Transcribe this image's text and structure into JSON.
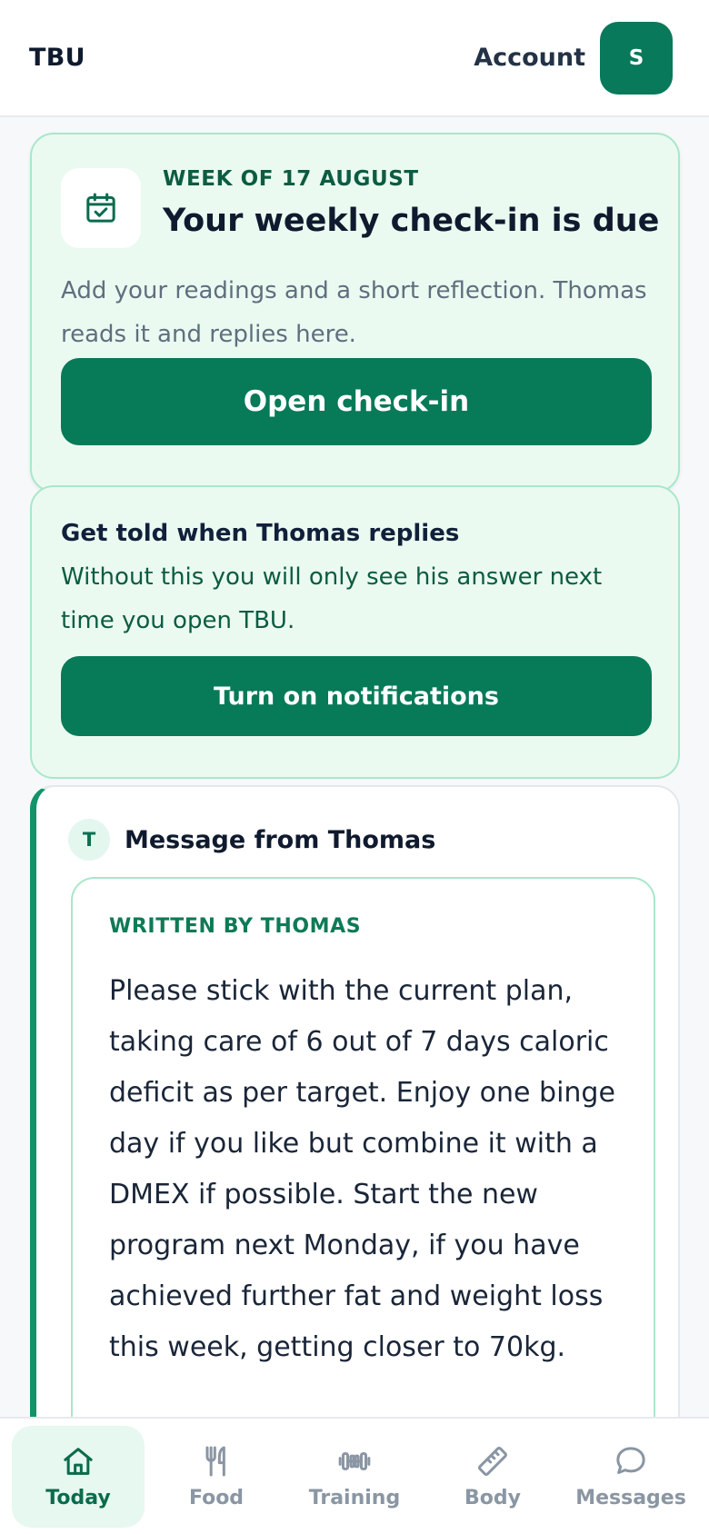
{
  "header": {
    "brand": "TBU",
    "account_label": "Account",
    "avatar_initial": "S"
  },
  "checkin_card": {
    "week_label": "WEEK OF 17 AUGUST",
    "title": "Your weekly check-in is due",
    "description": "Add your readings and a short reflection. Thomas reads it and replies here.",
    "button_label": "Open check-in",
    "icon": "calendar-check-icon"
  },
  "notify_card": {
    "title": "Get told when Thomas replies",
    "description": "Without this you will only see his answer next time you open TBU.",
    "button_label": "Turn on notifications"
  },
  "message_card": {
    "badge_initial": "T",
    "title": "Message from Thomas",
    "note_label": "WRITTEN BY THOMAS",
    "note_body": "Please stick with the current plan, taking care of 6 out of 7 days caloric deficit as per target. Enjoy one binge day if you like but combine it with a DMEX if possible. Start the new program next Monday, if you have achieved further fat and weight loss this week, getting closer to 70kg."
  },
  "bottom_nav": {
    "items": [
      {
        "label": "Today",
        "icon": "home-icon",
        "active": true
      },
      {
        "label": "Food",
        "icon": "fork-knife-icon",
        "active": false
      },
      {
        "label": "Training",
        "icon": "dumbbell-icon",
        "active": false
      },
      {
        "label": "Body",
        "icon": "ruler-icon",
        "active": false
      },
      {
        "label": "Messages",
        "icon": "chat-bubble-icon",
        "active": false
      }
    ]
  },
  "colors": {
    "accent": "#077a58",
    "card_bg": "#ebfaf1",
    "card_border": "#a9e7ca"
  }
}
